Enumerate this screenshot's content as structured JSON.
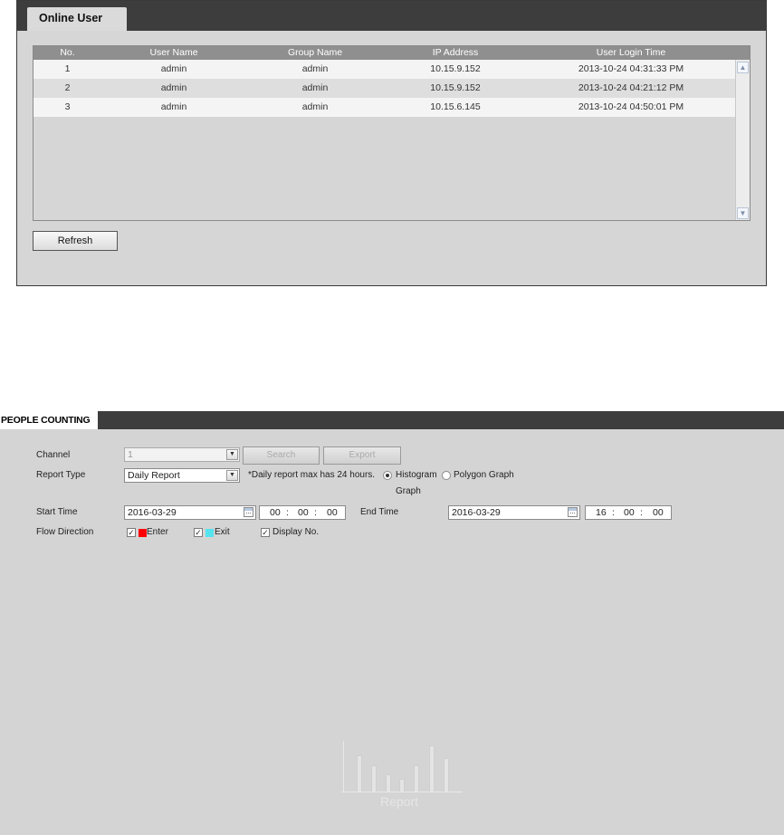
{
  "online_user": {
    "tab_label": "Online User",
    "columns": [
      "No.",
      "User Name",
      "Group Name",
      "IP Address",
      "User Login Time"
    ],
    "rows": [
      {
        "no": "1",
        "user": "admin",
        "group": "admin",
        "ip": "10.15.9.152",
        "login": "2013-10-24 04:31:33 PM"
      },
      {
        "no": "2",
        "user": "admin",
        "group": "admin",
        "ip": "10.15.9.152",
        "login": "2013-10-24 04:21:12 PM"
      },
      {
        "no": "3",
        "user": "admin",
        "group": "admin",
        "ip": "10.15.6.145",
        "login": "2013-10-24 04:50:01 PM"
      }
    ],
    "refresh_label": "Refresh"
  },
  "people_counting": {
    "title": "PEOPLE COUNTING",
    "channel_label": "Channel",
    "channel_value": "1",
    "search_label": "Search",
    "export_label": "Export",
    "report_type_label": "Report Type",
    "report_type_value": "Daily Report",
    "report_hint": "*Daily report max has 24 hours.",
    "graph_histogram_label": "Histogram",
    "graph_histogram_label_wrap": "Graph",
    "graph_polygon_label": "Polygon Graph",
    "graph_selected": "histogram",
    "start_time_label": "Start Time",
    "start_date": "2016-03-29",
    "start_hh": "00",
    "start_mm": "00",
    "start_ss": "00",
    "end_time_label": "End Time",
    "end_date": "2016-03-29",
    "end_hh": "16",
    "end_mm": "00",
    "end_ss": "00",
    "time_sep": ":",
    "flow_direction_label": "Flow Direction",
    "enter_label": "Enter",
    "enter_color": "#ff0000",
    "exit_label": "Exit",
    "exit_color": "#55e3f0",
    "display_no_label": "Display No.",
    "check_mark": "✓",
    "report_placeholder_label": "Report"
  }
}
